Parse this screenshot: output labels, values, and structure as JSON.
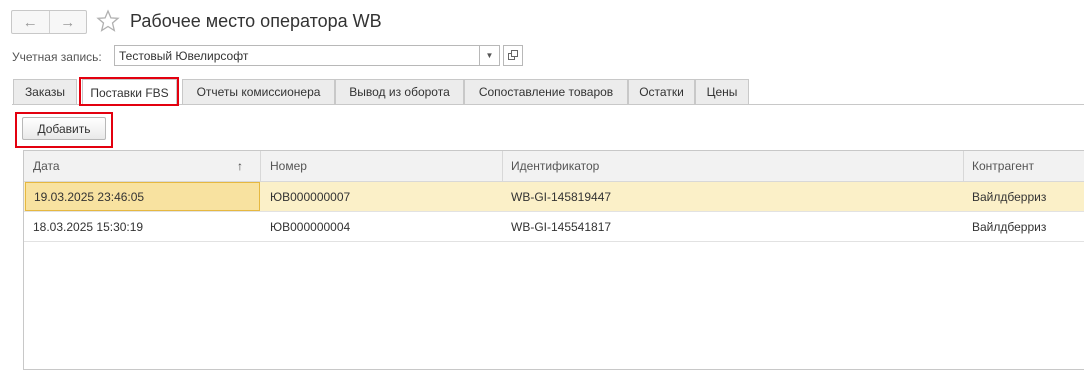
{
  "window": {
    "title": "Рабочее место оператора WB",
    "back_icon": "←",
    "forward_icon": "→"
  },
  "account": {
    "label": "Учетная запись:",
    "value": "Тестовый Ювелирсофт"
  },
  "tabs": [
    {
      "label": "Заказы"
    },
    {
      "label": "Поставки FBS",
      "active": true
    },
    {
      "label": "Отчеты комиссионера"
    },
    {
      "label": "Вывод из оборота"
    },
    {
      "label": "Сопоставление товаров"
    },
    {
      "label": "Остатки"
    },
    {
      "label": "Цены"
    }
  ],
  "toolbar": {
    "add_label": "Добавить"
  },
  "table": {
    "columns": [
      "Дата",
      "Номер",
      "Идентификатор",
      "Контрагент"
    ],
    "sort_indicator": "↑",
    "rows": [
      {
        "date": "19.03.2025 23:46:05",
        "number": "ЮВ000000007",
        "id": "WB-GI-145819447",
        "contractor": "Вайлдберриз",
        "selected": true
      },
      {
        "date": "18.03.2025 15:30:19",
        "number": "ЮВ000000004",
        "id": "WB-GI-145541817",
        "contractor": "Вайлдберриз"
      }
    ]
  },
  "colors": {
    "highlight": "#e3000f",
    "selected_row": "#fbf0c8"
  }
}
